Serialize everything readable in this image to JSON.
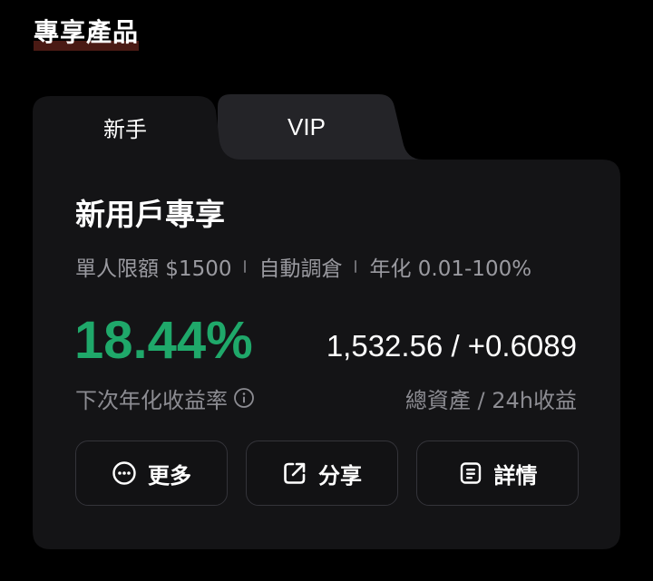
{
  "section": {
    "title": "專享產品"
  },
  "tabs": [
    {
      "label": "新手",
      "active": true
    },
    {
      "label": "VIP",
      "active": false
    }
  ],
  "card": {
    "title": "新用戶專享",
    "meta": {
      "limit": "單人限額 $1500",
      "auto": "自動調倉",
      "apr_range": "年化 0.01-100%"
    },
    "rate": "18.44%",
    "rate_label": "下次年化收益率",
    "assets": "1,532.56 / +0.6089",
    "assets_label": "總資產 / 24h收益",
    "buttons": {
      "more": "更多",
      "share": "分享",
      "detail": "詳情"
    }
  },
  "colors": {
    "background": "#000000",
    "card": "#141416",
    "inactive_tab": "#242428",
    "accent_green": "#1fa86a",
    "muted_text": "#8c8c92",
    "title_underline": "#4a1a14"
  },
  "icons": {
    "rate_info": "info-circle-icon",
    "more": "more-dots-icon",
    "share": "share-icon",
    "detail": "document-icon"
  }
}
